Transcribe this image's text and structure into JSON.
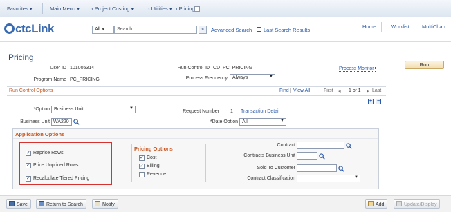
{
  "topnav": {
    "favorites": "Favorites",
    "main_menu": "Main Menu",
    "breadcrumb": [
      "Project Costing",
      "Utilities",
      "Pricing"
    ]
  },
  "header": {
    "logo": "ctcLink",
    "search_scope": "All",
    "search_placeholder": "Search",
    "advanced_search": "Advanced Search",
    "last_search_results": "Last Search Results",
    "home": "Home",
    "worklist": "Worklist",
    "multichannel": "MultiChan"
  },
  "page": {
    "title": "Pricing",
    "user_id_label": "User ID",
    "user_id": "101005314",
    "run_control_label": "Run Control ID",
    "run_control_id": "CD_PC_PRICING",
    "process_monitor": "Process Monitor",
    "run_button": "Run",
    "program_name_label": "Program Name",
    "program_name": "PC_PRICING",
    "process_frequency_label": "Process Frequency",
    "process_frequency": "Always"
  },
  "run_control_options": {
    "header": "Run Control Options",
    "find": "Find",
    "view_all": "View All",
    "first": "First",
    "range": "1 of 1",
    "last": "Last",
    "option_label": "*Option",
    "option_value": "Business Unit",
    "request_number_label": "Request Number",
    "request_number": "1",
    "transaction_detail": "Transaction Detail",
    "business_unit_label": "Business Unit",
    "business_unit": "WA220",
    "date_option_label": "*Date Option",
    "date_option": "All"
  },
  "application_options": {
    "header": "Application Options",
    "reprice_rows": "Reprice Rows",
    "price_unpriced_rows": "Price Unpriced Rows",
    "recalculate_tiered_pricing": "Recalculate Tiered Pricing",
    "pricing_options_header": "Pricing Options",
    "cost": "Cost",
    "billing": "Billing",
    "revenue": "Revenue",
    "contract_label": "Contract",
    "contracts_bu_label": "Contracts Business Unit",
    "sold_to_label": "Sold To Customer",
    "contract_classification_label": "Contract Classification"
  },
  "checkbox_states": {
    "reprice_rows": true,
    "price_unpriced_rows": true,
    "recalculate_tiered_pricing": true,
    "cost": true,
    "billing": true,
    "revenue": false
  },
  "footer": {
    "save": "Save",
    "return_to_search": "Return to Search",
    "notify": "Notify",
    "add": "Add",
    "update_display": "Update/Display"
  },
  "colors": {
    "accent_orange": "#c9551c",
    "link_blue": "#2b5aa8",
    "highlight_red": "#d8322e"
  }
}
